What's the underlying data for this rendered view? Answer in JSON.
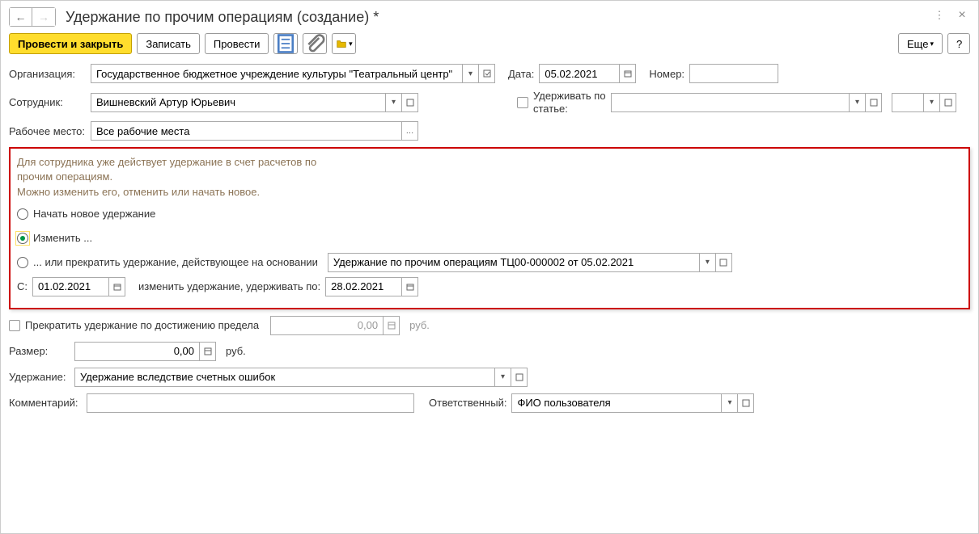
{
  "header": {
    "title": "Удержание по прочим операциям (создание) *"
  },
  "toolbar": {
    "post_close": "Провести и закрыть",
    "save": "Записать",
    "post": "Провести",
    "more": "Еще",
    "help": "?"
  },
  "labels": {
    "org": "Организация:",
    "date": "Дата:",
    "number": "Номер:",
    "employee": "Сотрудник:",
    "deduct_by": "Удерживать по статье:",
    "workplace": "Рабочее место:",
    "from": "С:",
    "change_hold": "изменить удержание, удерживать по:",
    "limit_stop": "Прекратить удержание по достижению предела",
    "rub": "руб.",
    "amount": "Размер:",
    "deduction": "Удержание:",
    "comment": "Комментарий:",
    "responsible": "Ответственный:"
  },
  "values": {
    "org": "Государственное бюджетное учреждение культуры \"Театральный центр\"",
    "date": "05.02.2021",
    "number": "",
    "employee": "Вишневский Артур Юрьевич",
    "workplace": "Все рабочие места",
    "basis": "Удержание по прочим операциям ТЦ00-000002 от 05.02.2021",
    "from_date": "01.02.2021",
    "to_date": "28.02.2021",
    "limit": "0,00",
    "amount": "0,00",
    "deduction": "Удержание вследствие счетных ошибок",
    "comment": "",
    "responsible": "ФИО пользователя"
  },
  "hints": {
    "line1": "Для сотрудника уже действует удержание в счет расчетов по прочим операциям.",
    "line2": "Можно изменить его, отменить или начать новое."
  },
  "radio": {
    "start_new": "Начать новое удержание",
    "change": "Изменить ...",
    "stop": "... или прекратить удержание, действующее на основании"
  }
}
